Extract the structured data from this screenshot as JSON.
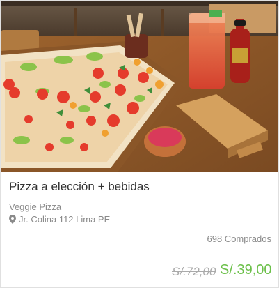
{
  "deal": {
    "title": "Pizza a elección + bebidas",
    "merchant": "Veggie Pizza",
    "location": "Jr. Colina 112 Lima PE",
    "sold_count": "698 Comprados",
    "original_price": "S/.72,00",
    "price": "S/.39,00"
  },
  "colors": {
    "accent_green": "#6cc04a",
    "muted_text": "#8a8a8a"
  },
  "icons": {
    "location": "map-pin-icon"
  }
}
